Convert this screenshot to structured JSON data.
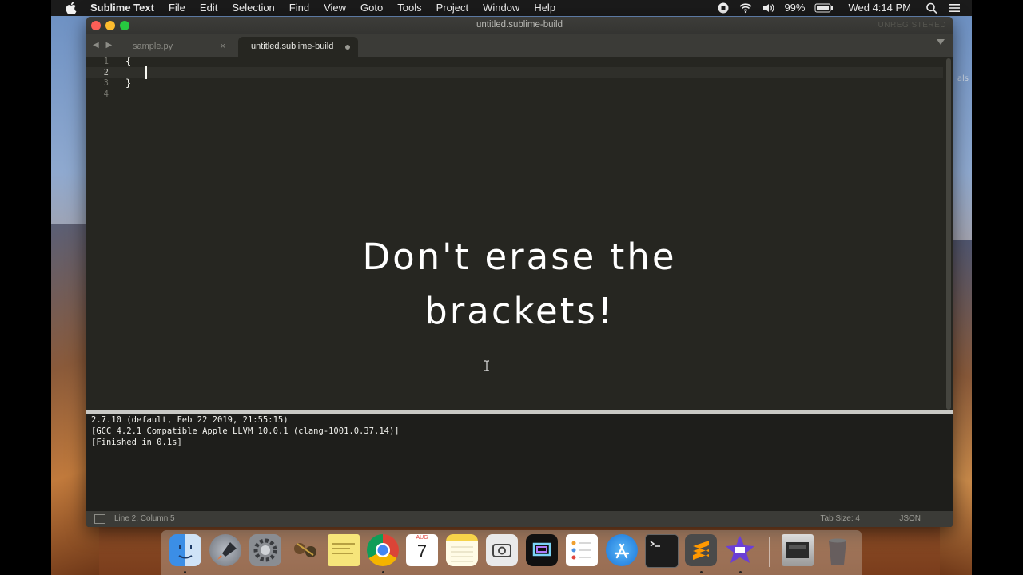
{
  "menubar": {
    "app_name": "Sublime Text",
    "menus": [
      "File",
      "Edit",
      "Selection",
      "Find",
      "View",
      "Goto",
      "Tools",
      "Project",
      "Window",
      "Help"
    ],
    "battery": "99%",
    "clock": "Wed 4:14 PM"
  },
  "window": {
    "title": "untitled.sublime-build",
    "unregistered": "UNREGISTERED"
  },
  "tabs": [
    {
      "label": "sample.py",
      "active": false
    },
    {
      "label": "untitled.sublime-build",
      "active": true
    }
  ],
  "editor": {
    "line_numbers": [
      "1",
      "2",
      "3",
      "4"
    ],
    "lines": [
      "{",
      "",
      "}",
      ""
    ],
    "current_line": 2,
    "overlay_line1": "Don't erase the",
    "overlay_line2": "brackets!"
  },
  "output": {
    "lines": [
      "2.7.10 (default, Feb 22 2019, 21:55:15)",
      "[GCC 4.2.1 Compatible Apple LLVM 10.0.1 (clang-1001.0.37.14)]",
      "[Finished in 0.1s]"
    ]
  },
  "statusbar": {
    "position": "Line 2, Column 5",
    "tab_size": "Tab Size: 4",
    "syntax": "JSON"
  },
  "desktop_fragment": "als",
  "dock": {
    "apps": [
      "finder-icon",
      "launchpad-icon",
      "system-preferences-icon",
      "contacts-icon",
      "stickies-icon",
      "chrome-icon",
      "calendar-icon",
      "notes-icon",
      "screenshot-icon",
      "screen-recorder-icon",
      "reminders-icon",
      "app-store-icon",
      "terminal-icon",
      "sublime-text-icon",
      "imovie-icon"
    ],
    "calendar_day": "7",
    "calendar_month": "AUG"
  },
  "colors": {
    "editor_bg": "#262621",
    "panel_bg": "#1e1e1b",
    "text": "#f8f8f2"
  }
}
